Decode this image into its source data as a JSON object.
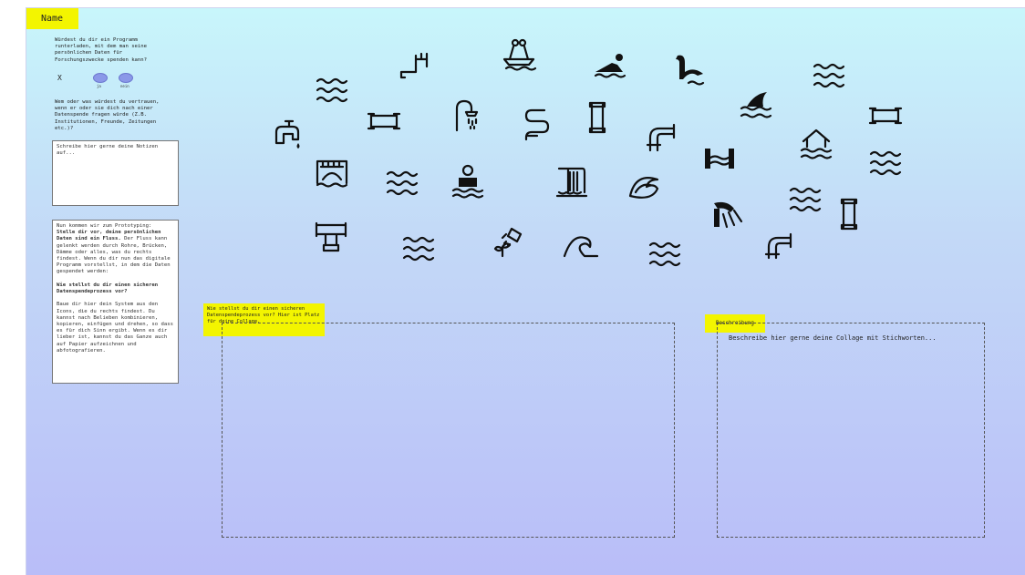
{
  "name_label": "Name",
  "question1": "Würdest du dir ein Programm runterladen, mit dem man seine persönlichen Daten für Forschungszwecke spenden kann?",
  "answer_mark": "X",
  "options": [
    "ja",
    "nein"
  ],
  "question2": "Wem oder was würdest du vertrauen, wenn er oder sie dich nach einer Datenspende fragen würde (Z.B. Institutionen, Freunde, Zeitungen etc.)?",
  "notes_placeholder": "Schreibe hier gerne deine Notizen auf...",
  "instructions": {
    "p1": "Nun kommen wir zum Prototyping:",
    "p1_bold": "Stelle dir vor, deine persönlichen Daten sind ein Fluss.",
    "p1_rest": "Der Fluss kann gelenkt werden durch Rohre, Brücken, Dämme oder alles, was du rechts findest. Wenn du dir nun das digitale Programm vorstellst, in dem die Daten gespendet werden:",
    "p2_bold": "Wie stellst du dir einen sicheren Datenspendeprozess vor?",
    "p3": "Baue dir hier dein System aus den Icons, die du rechts findest. Du kannst nach Belieben kombinieren, kopieren, einfügen und drehen, so dass es für dich Sinn ergibt. Wenn es dir lieber ist, kannst du das Ganze auch auf Papier aufzeichnen und abfotografieren."
  },
  "collage_note": "Wie stellst du dir einen sicheren Datenspendeprozess vor? Hier ist Platz für deine Collage.",
  "description_note": "Beschreibung",
  "description_placeholder": "Beschreibe hier gerne deine Collage mit Stichworten...",
  "icons": [
    "pipe-icon",
    "boat-icon",
    "swimmer-icon",
    "sea-monster-icon",
    "waves-icon",
    "waves-icon",
    "tap-icon",
    "pipe-icon",
    "shower-icon",
    "pipe-icon",
    "pipe-icon",
    "pipe-icon",
    "shark-fin-icon",
    "flooded-house-icon",
    "pipe-icon",
    "waves-icon",
    "bridge-icon",
    "waves-icon",
    "diver-icon",
    "waterfall-icon",
    "wave-swirl-icon",
    "waves-icon",
    "dam-icon",
    "pipe-icon",
    "pipe-valve-icon",
    "waves-icon",
    "watering-can-icon",
    "wave-icon",
    "waves-icon",
    "pipe-icon",
    "watermill-icon",
    "waves-icon"
  ]
}
